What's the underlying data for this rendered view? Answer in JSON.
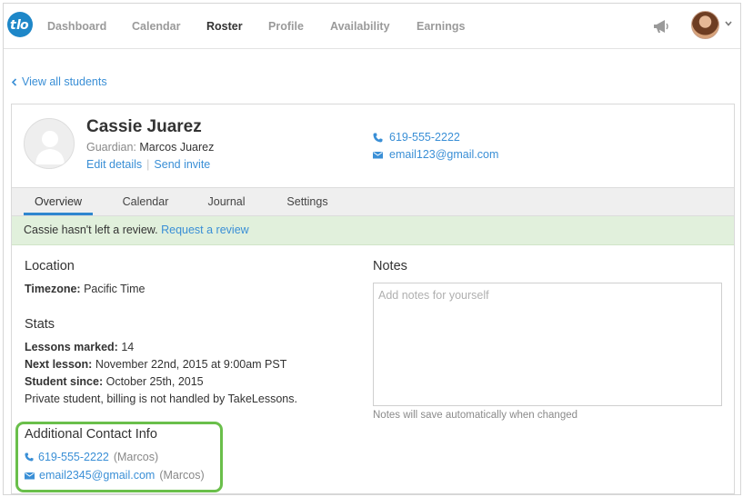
{
  "nav": {
    "logo_text": "t♄",
    "items": [
      "Dashboard",
      "Calendar",
      "Roster",
      "Profile",
      "Availability",
      "Earnings"
    ],
    "active": "Roster"
  },
  "back_link": "View all students",
  "student": {
    "name": "Cassie Juarez",
    "guardian_label": "Guardian:",
    "guardian_name": "Marcos Juarez",
    "edit_label": "Edit details",
    "invite_label": "Send invite",
    "phone": "619-555-2222",
    "email": "email123@gmail.com"
  },
  "tabs": [
    "Overview",
    "Calendar",
    "Journal",
    "Settings"
  ],
  "active_tab": "Overview",
  "review": {
    "text": "Cassie hasn't left a review.",
    "link": "Request a review"
  },
  "location": {
    "title": "Location",
    "timezone_label": "Timezone:",
    "timezone_value": "Pacific Time"
  },
  "stats": {
    "title": "Stats",
    "lessons_label": "Lessons marked:",
    "lessons_value": "14",
    "next_label": "Next lesson:",
    "next_value": "November 22nd, 2015 at 9:00am PST",
    "since_label": "Student since:",
    "since_value": "October 25th, 2015",
    "billing_note": "Private student, billing is not handled by TakeLessons."
  },
  "notes": {
    "title": "Notes",
    "placeholder": "Add notes for yourself",
    "hint": "Notes will save automatically when changed"
  },
  "additional": {
    "title": "Additional Contact Info",
    "phone": "619-555-2222",
    "phone_owner": "(Marcos)",
    "email": "email2345@gmail.com",
    "email_owner": "(Marcos)"
  },
  "colors": {
    "link": "#3a8fd6",
    "brand": "#1e87c8",
    "banner_bg": "#e1f0dc",
    "highlight_border": "#6abf4b",
    "tab_active": "#2f87cf"
  }
}
